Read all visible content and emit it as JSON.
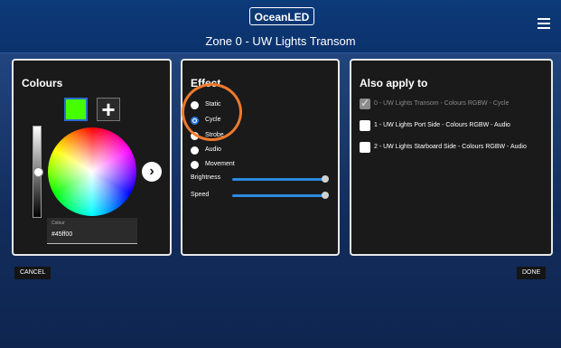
{
  "header": {
    "logo": "OceanLED",
    "title": "Zone 0 - UW Lights Transom"
  },
  "colours": {
    "title": "Colours",
    "swatch_color": "#45ff00",
    "plus_label": "+",
    "next_label": "›",
    "field_label": "Colour",
    "field_value": "#45ff00"
  },
  "effect": {
    "title": "Effect",
    "options": [
      "Static",
      "Cycle",
      "Strobe",
      "Audio",
      "Movement"
    ],
    "selected": "Cycle",
    "brightness_label": "Brightness",
    "brightness_value": 1.0,
    "speed_label": "Speed",
    "speed_value": 1.0
  },
  "apply": {
    "title": "Also apply to",
    "items": [
      {
        "text": "0 - UW Lights Transom - Colours RGBW - Cycle",
        "checked": true,
        "disabled": true
      },
      {
        "text": "1 - UW Lights Port Side - Colours RGBW - Audio",
        "checked": false,
        "disabled": false
      },
      {
        "text": "2 - UW Lights Starboard Side - Colours RGBW - Audio",
        "checked": false,
        "disabled": false
      }
    ]
  },
  "buttons": {
    "cancel": "CANCEL",
    "done": "DONE"
  }
}
